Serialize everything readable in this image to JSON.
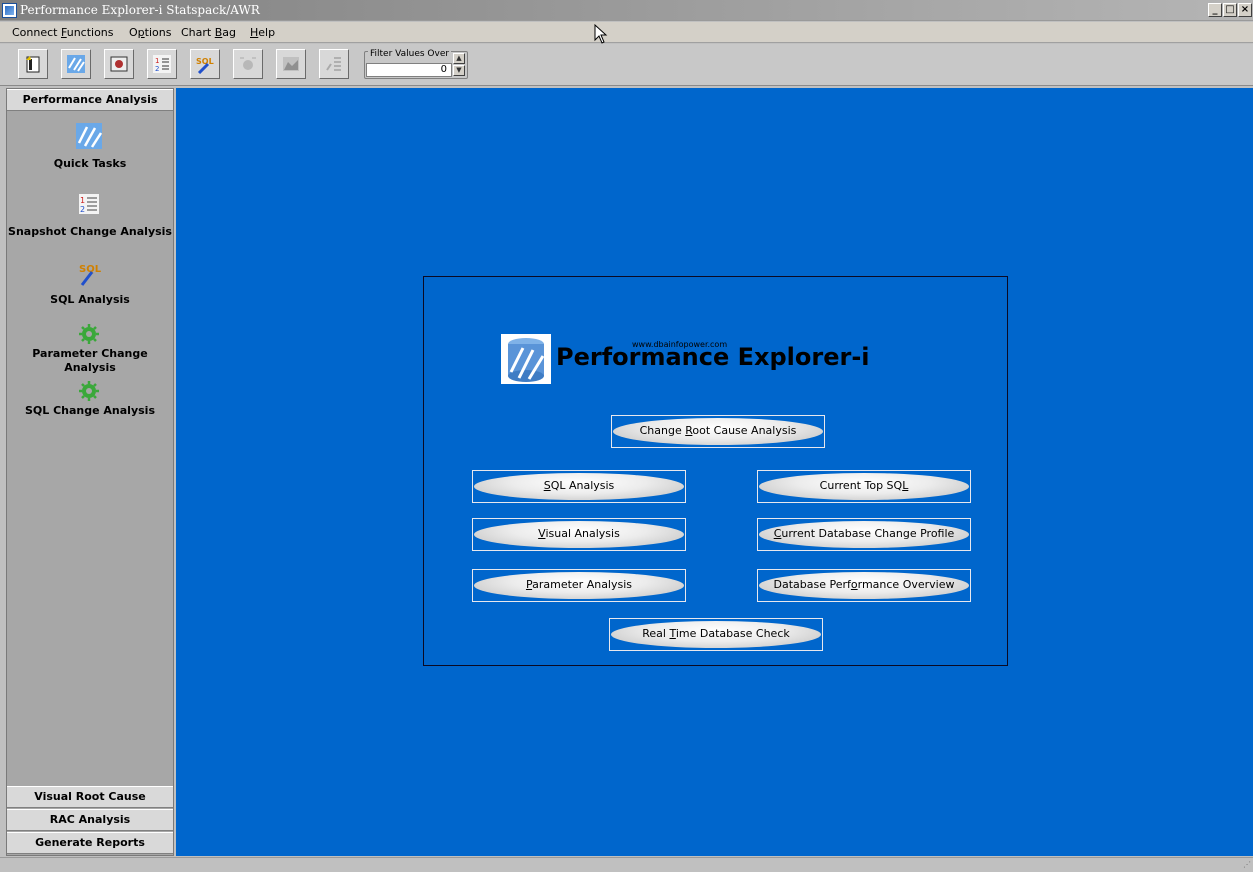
{
  "window": {
    "title": "Performance Explorer-i Statspack/AWR",
    "minimize": "_",
    "maximize": "□",
    "close": "×"
  },
  "menu": {
    "items": [
      {
        "pre": "Connect ",
        "key": "F",
        "post": "unctions"
      },
      {
        "pre": "O",
        "key": "p",
        "post": "tions"
      },
      {
        "pre": "Chart ",
        "key": "B",
        "post": "ag"
      },
      {
        "pre": "",
        "key": "H",
        "post": "elp"
      }
    ]
  },
  "toolbar": {
    "buttons": [
      "new-connection-icon",
      "quick-tasks-icon",
      "snapshot-icon",
      "snapshot-change-icon",
      "sql-analysis-icon",
      "record-icon",
      "chart-icon",
      "compare-icon"
    ],
    "filter_label": "Filter Values Over",
    "filter_value": "0"
  },
  "sidebar": {
    "header": "Performance Analysis",
    "items": [
      {
        "label": "Quick Tasks",
        "icon": "quick-tasks-icon"
      },
      {
        "label": "Snapshot Change Analysis",
        "icon": "snapshot-change-icon"
      },
      {
        "label": "SQL Analysis",
        "icon": "sql-icon"
      },
      {
        "label": "Parameter Change Analysis",
        "icon": "gear-icon"
      },
      {
        "label": "SQL Change Analysis",
        "icon": "gear-icon"
      }
    ],
    "footer_sections": [
      "Visual Root Cause Analysis",
      "RAC Analysis",
      "Generate Reports"
    ]
  },
  "main": {
    "logo_url": "www.dbainfopower.com",
    "logo_title": "Performance Explorer-i",
    "buttons": {
      "change_root": {
        "pre": "Change ",
        "key": "R",
        "post": "oot Cause Analysis"
      },
      "sql": {
        "pre": "",
        "key": "S",
        "post": "QL Analysis"
      },
      "current_top_sql": {
        "pre": "Current Top SQ",
        "key": "L",
        "post": ""
      },
      "visual": {
        "pre": "",
        "key": "V",
        "post": "isual Analysis"
      },
      "current_db_change": {
        "pre": "",
        "key": "C",
        "post": "urrent Database Change Profile"
      },
      "parameter": {
        "pre": "",
        "key": "P",
        "post": "arameter Analysis"
      },
      "db_perf_overview": {
        "pre": "Database Perf",
        "key": "o",
        "post": "rmance Overview"
      },
      "real_time": {
        "pre": "Real ",
        "key": "T",
        "post": "ime Database Check"
      }
    }
  },
  "status": {
    "grip": "⋰"
  },
  "colors": {
    "main_bg": "#0066cc",
    "sidebar_bg": "#a7a7a7",
    "toolbar_bg": "#c8c8c8"
  }
}
